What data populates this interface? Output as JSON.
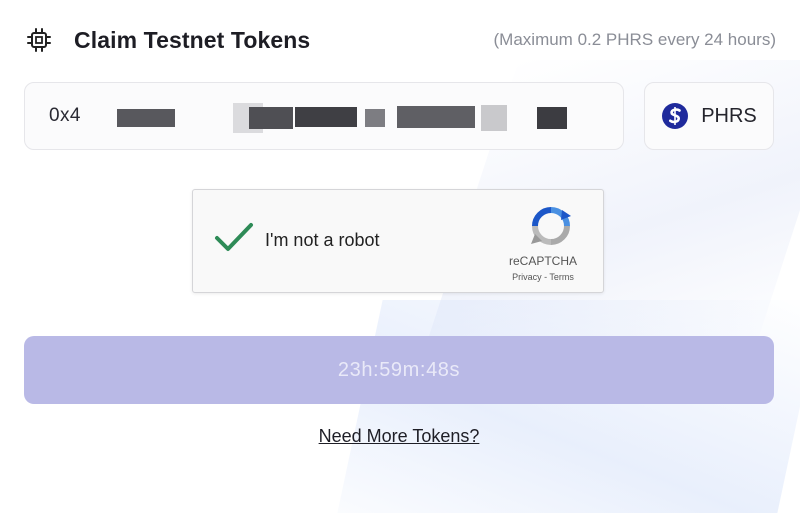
{
  "header": {
    "title": "Claim Testnet Tokens",
    "limit_note": "(Maximum 0.2 PHRS every 24 hours)",
    "icon": "chip-icon"
  },
  "address_field": {
    "value_prefix": "0x4"
  },
  "token": {
    "symbol": "PHRS",
    "icon": "pharos-token-icon",
    "icon_color": "#1f2a9c"
  },
  "captcha": {
    "label": "I'm not a robot",
    "checked": true,
    "check_color": "#2e8b57",
    "brand": "reCAPTCHA",
    "links": "Privacy - Terms"
  },
  "claim_button": {
    "label": "23h:59m:48s",
    "background": "#b9b9e6"
  },
  "footer": {
    "more_link": "Need More Tokens?"
  }
}
